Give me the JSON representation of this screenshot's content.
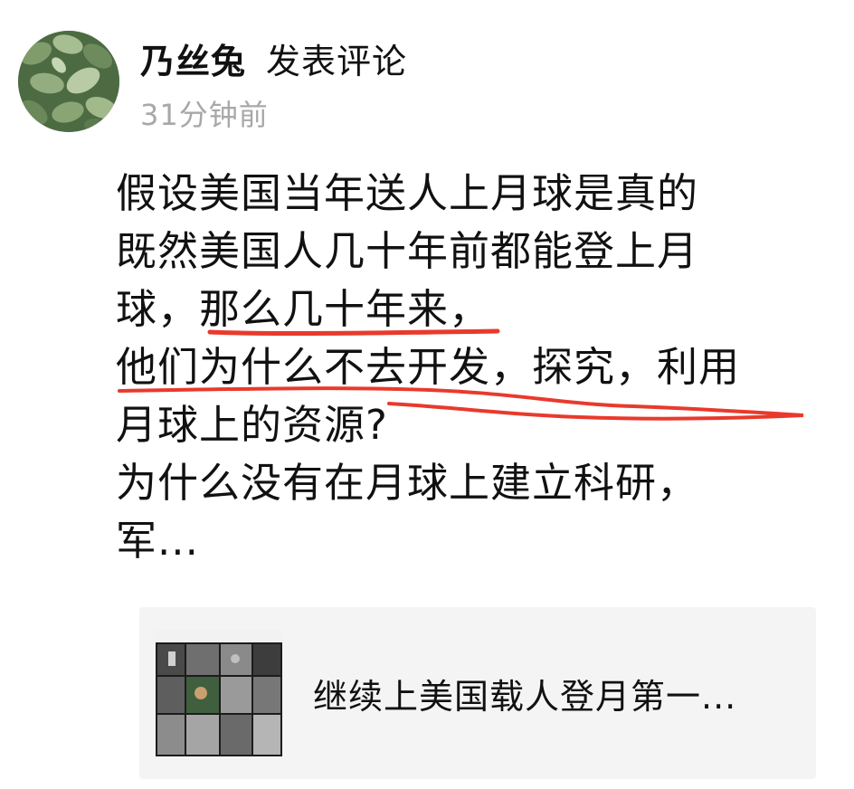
{
  "comment": {
    "author": {
      "name": "乃丝兔",
      "action": "发表评论",
      "avatar_icon": "avatar-green-leaves-image"
    },
    "timestamp": "31分钟前",
    "text_lines": [
      "假设美国当年送人上月球是真的",
      "既然美国人几十年前都能登上月",
      "球，那么几十年来，",
      "他们为什么不去开发，探究，利用",
      "月球上的资源?",
      "为什么没有在月球上建立科研，",
      "军..."
    ],
    "underline_color": "#e83a2c",
    "shared_link": {
      "title": "继续上美国载人登月第一...",
      "thumbnail_icon": "lunar-photo-grid-thumbnail"
    }
  }
}
